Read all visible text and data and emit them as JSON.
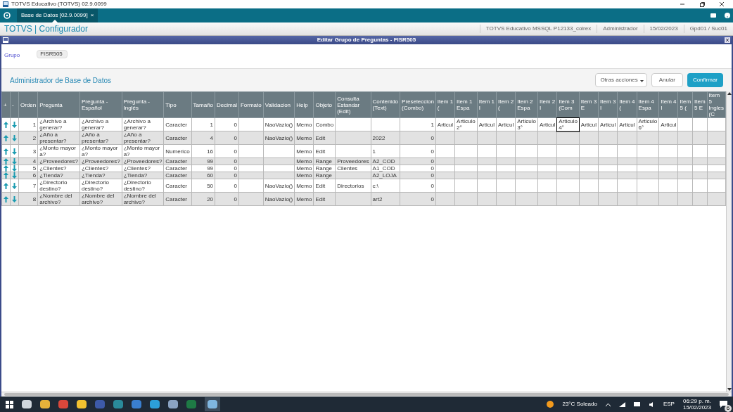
{
  "window": {
    "title": "TOTVS Educativo (TOTVS) 02.9.0099"
  },
  "tabs": [
    {
      "label": "Base de Datos [02.9.0099]",
      "close": "×",
      "selected": true
    }
  ],
  "app_header": {
    "title": "TOTVS | Configurador",
    "info": [
      "TOTVS Educativo MSSQL P12133_colrex",
      "Administrador",
      "15/02/2023",
      "Gpd01 / Suc01"
    ]
  },
  "dialog": {
    "title": "Editar Grupo de Preguntas - FISR505",
    "group_label": "Grupo",
    "group_value": "FISR505",
    "section_title": "Administrador de Base de Datos",
    "buttons": [
      {
        "label": "Otras acciones",
        "kind": "menu"
      },
      {
        "label": "Anular",
        "kind": "plain"
      },
      {
        "label": "Confirmar",
        "kind": "primary"
      }
    ]
  },
  "table": {
    "columns": [
      {
        "label": "+",
        "kind": "up"
      },
      {
        "label": "-",
        "kind": "down"
      },
      {
        "label": "Orden",
        "kind": "number"
      },
      {
        "label": "Pregunta",
        "kind": "text"
      },
      {
        "label": "Pregunta - Español",
        "kind": "text"
      },
      {
        "label": "Pregunta - Inglés",
        "kind": "text"
      },
      {
        "label": "Tipo",
        "kind": "text"
      },
      {
        "label": "Tamaño",
        "kind": "number"
      },
      {
        "label": "Decimal",
        "kind": "number"
      },
      {
        "label": "Formato",
        "kind": "text"
      },
      {
        "label": "Validacion",
        "kind": "text"
      },
      {
        "label": "Help",
        "kind": "text"
      },
      {
        "label": "Objeto",
        "kind": "text"
      },
      {
        "label": "Consulta Estandar (Edit)",
        "kind": "text"
      },
      {
        "label": "Contenido (Text)",
        "kind": "text"
      },
      {
        "label": "Preseleccion (Combo)",
        "kind": "number"
      },
      {
        "label": "Item 1 (",
        "kind": "text"
      },
      {
        "label": "Item 1 Espa",
        "kind": "text"
      },
      {
        "label": "Item 1 I",
        "kind": "text"
      },
      {
        "label": "Item 2 (",
        "kind": "text"
      },
      {
        "label": "Item 2 Espa",
        "kind": "text"
      },
      {
        "label": "Item 2 I",
        "kind": "text"
      },
      {
        "label": "Item 3 (Com",
        "kind": "text"
      },
      {
        "label": "Item 3 E",
        "kind": "text"
      },
      {
        "label": "Item 3 I",
        "kind": "text"
      },
      {
        "label": "Item 4 (",
        "kind": "text"
      },
      {
        "label": "Item 4 Espa",
        "kind": "text"
      },
      {
        "label": "Item 4 I",
        "kind": "text"
      },
      {
        "label": "Item 5 (",
        "kind": "text"
      },
      {
        "label": "Item 5 E",
        "kind": "text"
      },
      {
        "label": "Item 5 Ingles (C",
        "kind": "text"
      }
    ],
    "rows": [
      {
        "cells": [
          "",
          "",
          "1",
          "¿Archivo a generar?",
          "¿Archivo a generar?",
          "¿Archivo a generar?",
          "Caracter",
          "1",
          "0",
          "",
          "NaoVazio()",
          "Memo",
          "Combo",
          "",
          "",
          "1",
          "Articul",
          "Articulo 2°",
          "Articul",
          "Articul",
          "Articulo 3°",
          "Articul",
          {
            "text": "Articulo 4°",
            "focused": true
          },
          "Articul",
          "Articul",
          "Articul",
          "Articulo 6°",
          "Articul",
          "",
          "",
          ""
        ]
      },
      {
        "cells": [
          "",
          "",
          "2",
          "¿Año a presentar?",
          "¿Año a presentar?",
          "¿Año a presentar?",
          "Caracter",
          "4",
          "0",
          "",
          "NaoVazio()",
          "Memo",
          "Edit",
          "",
          "2022",
          "0",
          "",
          "",
          "",
          "",
          "",
          "",
          "",
          "",
          "",
          "",
          "",
          "",
          "",
          "",
          ""
        ]
      },
      {
        "cells": [
          "",
          "",
          "3",
          "¿Monto mayor a?",
          "¿Monto mayor a?",
          "¿Monto mayor a?",
          "Numerico",
          "16",
          "0",
          "",
          "",
          "Memo",
          "Edit",
          "",
          "1",
          "0",
          "",
          "",
          "",
          "",
          "",
          "",
          "",
          "",
          "",
          "",
          "",
          "",
          "",
          "",
          ""
        ]
      },
      {
        "cells": [
          "",
          "",
          "4",
          "¿Proveedores?",
          "¿Proveedores?",
          "¿Proveedores?",
          "Caracter",
          "99",
          "0",
          "",
          "",
          "Memo",
          "Range",
          "Proveedores",
          "A2_COD",
          "0",
          "",
          "",
          "",
          "",
          "",
          "",
          "",
          "",
          "",
          "",
          "",
          "",
          "",
          "",
          ""
        ]
      },
      {
        "cells": [
          "",
          "",
          "5",
          "¿Clientes?",
          "¿Clientes?",
          "¿Clientes?",
          "Caracter",
          "99",
          "0",
          "",
          "",
          "Memo",
          "Range",
          "Clientes",
          "A1_COD",
          "0",
          "",
          "",
          "",
          "",
          "",
          "",
          "",
          "",
          "",
          "",
          "",
          "",
          "",
          "",
          ""
        ]
      },
      {
        "cells": [
          "",
          "",
          "6",
          "¿Tienda?",
          "¿Tienda?",
          "¿Tienda?",
          "Caracter",
          "60",
          "0",
          "",
          "",
          "Memo",
          "Range",
          "",
          "A2_LOJA",
          "0",
          "",
          "",
          "",
          "",
          "",
          "",
          "",
          "",
          "",
          "",
          "",
          "",
          "",
          "",
          ""
        ]
      },
      {
        "cells": [
          "",
          "",
          "7",
          "¿Directorio destino?",
          "¿Directorio destino?",
          "¿Directorio destino?",
          "Caracter",
          "50",
          "0",
          "",
          "NaoVazio()",
          "Memo",
          "Edit",
          "Directorios",
          "c:\\",
          "0",
          "",
          "",
          "",
          "",
          "",
          "",
          "",
          "",
          "",
          "",
          "",
          "",
          "",
          "",
          ""
        ]
      },
      {
        "cells": [
          "",
          "",
          "8",
          "¿Nombre del archivo?",
          "¿Nombre del archivo?",
          "¿Nombre del archivo?",
          "Caracter",
          "20",
          "0",
          "",
          "NaoVazio()",
          "Memo",
          "Edit",
          "",
          "art2",
          "0",
          "",
          "",
          "",
          "",
          "",
          "",
          "",
          "",
          "",
          "",
          "",
          "",
          "",
          "",
          ""
        ]
      }
    ]
  },
  "taskbar": {
    "weather": "23°C Soleado",
    "language": "ESP",
    "time": "06:29 p. m.",
    "date": "15/02/2023",
    "notifications": "6"
  }
}
